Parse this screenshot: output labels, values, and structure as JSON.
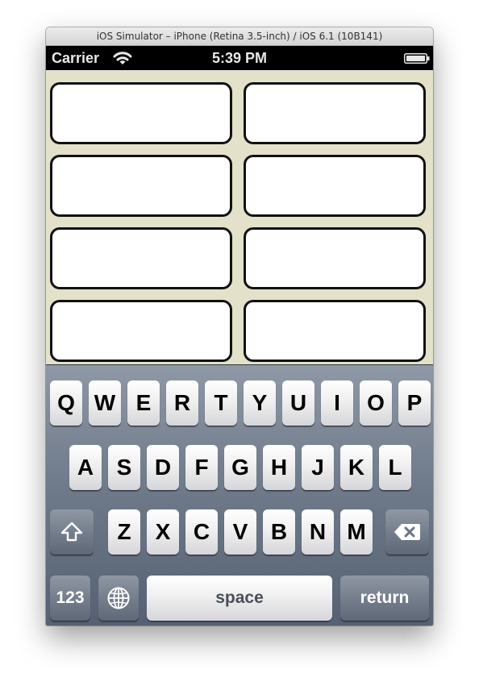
{
  "window": {
    "title": "iOS Simulator – iPhone (Retina 3.5-inch) / iOS 6.1 (10B141)"
  },
  "status_bar": {
    "carrier": "Carrier",
    "time": "5:39 PM",
    "icons": [
      "wifi-icon",
      "battery-icon"
    ]
  },
  "fields": [
    {
      "value": ""
    },
    {
      "value": ""
    },
    {
      "value": ""
    },
    {
      "value": ""
    },
    {
      "value": ""
    },
    {
      "value": ""
    },
    {
      "value": ""
    },
    {
      "value": ""
    }
  ],
  "keyboard": {
    "row1": [
      "Q",
      "W",
      "E",
      "R",
      "T",
      "Y",
      "U",
      "I",
      "O",
      "P"
    ],
    "row2": [
      "A",
      "S",
      "D",
      "F",
      "G",
      "H",
      "J",
      "K",
      "L"
    ],
    "row3": [
      "Z",
      "X",
      "C",
      "V",
      "B",
      "N",
      "M"
    ],
    "shift_icon": "shift-arrow-icon",
    "delete_icon": "backspace-icon",
    "numbers_label": "123",
    "globe_icon": "globe-icon",
    "space_label": "space",
    "return_label": "return"
  },
  "colors": {
    "background": "#e3e1c9",
    "keyboard": "#6d7888",
    "status_bar": "#000000"
  }
}
